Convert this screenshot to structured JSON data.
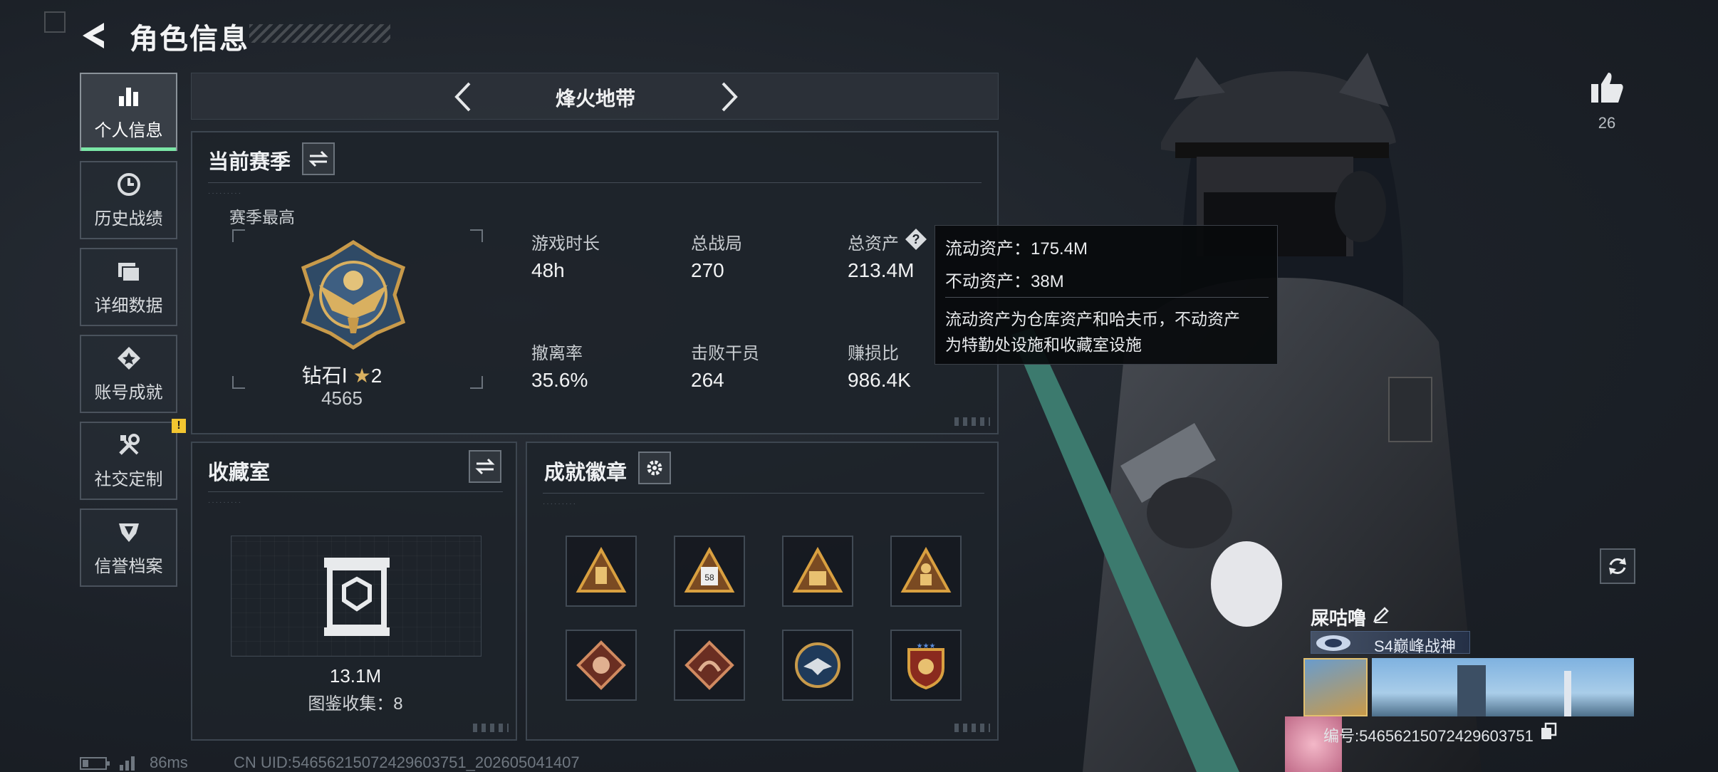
{
  "header": {
    "title": "角色信息"
  },
  "sidebar": {
    "items": [
      {
        "label": "个人信息",
        "icon": "bar-chart-icon",
        "active": true
      },
      {
        "label": "历史战绩",
        "icon": "history-clock-icon"
      },
      {
        "label": "详细数据",
        "icon": "folder-icon"
      },
      {
        "label": "账号成就",
        "icon": "achievement-star-icon"
      },
      {
        "label": "社交定制",
        "icon": "tools-icon",
        "badge": "!"
      },
      {
        "label": "信誉档案",
        "icon": "shield-emblem-icon"
      }
    ]
  },
  "mode_bar": {
    "title": "烽火地带"
  },
  "season_panel": {
    "title": "当前赛季",
    "best_label": "赛季最高",
    "rank": {
      "name": "钻石Ⅰ",
      "stars": "2",
      "score": "4565"
    },
    "stats": [
      {
        "label": "游戏时长",
        "value": "48h"
      },
      {
        "label": "总战局",
        "value": "270"
      },
      {
        "label": "总资产",
        "value": "213.4M"
      },
      {
        "label": "撤离率",
        "value": "35.6%"
      },
      {
        "label": "击败干员",
        "value": "264"
      },
      {
        "label": "赚损比",
        "value": "986.4K"
      }
    ]
  },
  "tooltip": {
    "line1": "流动资产：175.4M",
    "line2": "不动资产：38M",
    "desc1": "流动资产为仓库资产和哈夫币，不动资产",
    "desc2": "为特勤处设施和收藏室设施"
  },
  "collection_panel": {
    "title": "收藏室",
    "value": "13.1M",
    "catalog": "图鉴收集：8"
  },
  "achievement_panel": {
    "title": "成就徽章",
    "badges": [
      "badge-triangle-lantern",
      "badge-triangle-sign-58",
      "badge-triangle-crate",
      "badge-triangle-soldier",
      "badge-diamond-beast",
      "badge-diamond-dragon",
      "badge-round-eagle",
      "badge-shield-stars"
    ]
  },
  "like": {
    "count": "26"
  },
  "profile": {
    "name": "屎咕噜",
    "title_badge": "S4巅峰战神",
    "uid_line": "编号:5465621507242960375​1"
  },
  "footer": {
    "ping": "86ms",
    "uid": "CN UID:5465621507242960375​1_202605041407"
  },
  "colors": {
    "accent_green": "#7be6a6",
    "warning_yellow": "#f2c530",
    "gold": "#c89a4a"
  }
}
